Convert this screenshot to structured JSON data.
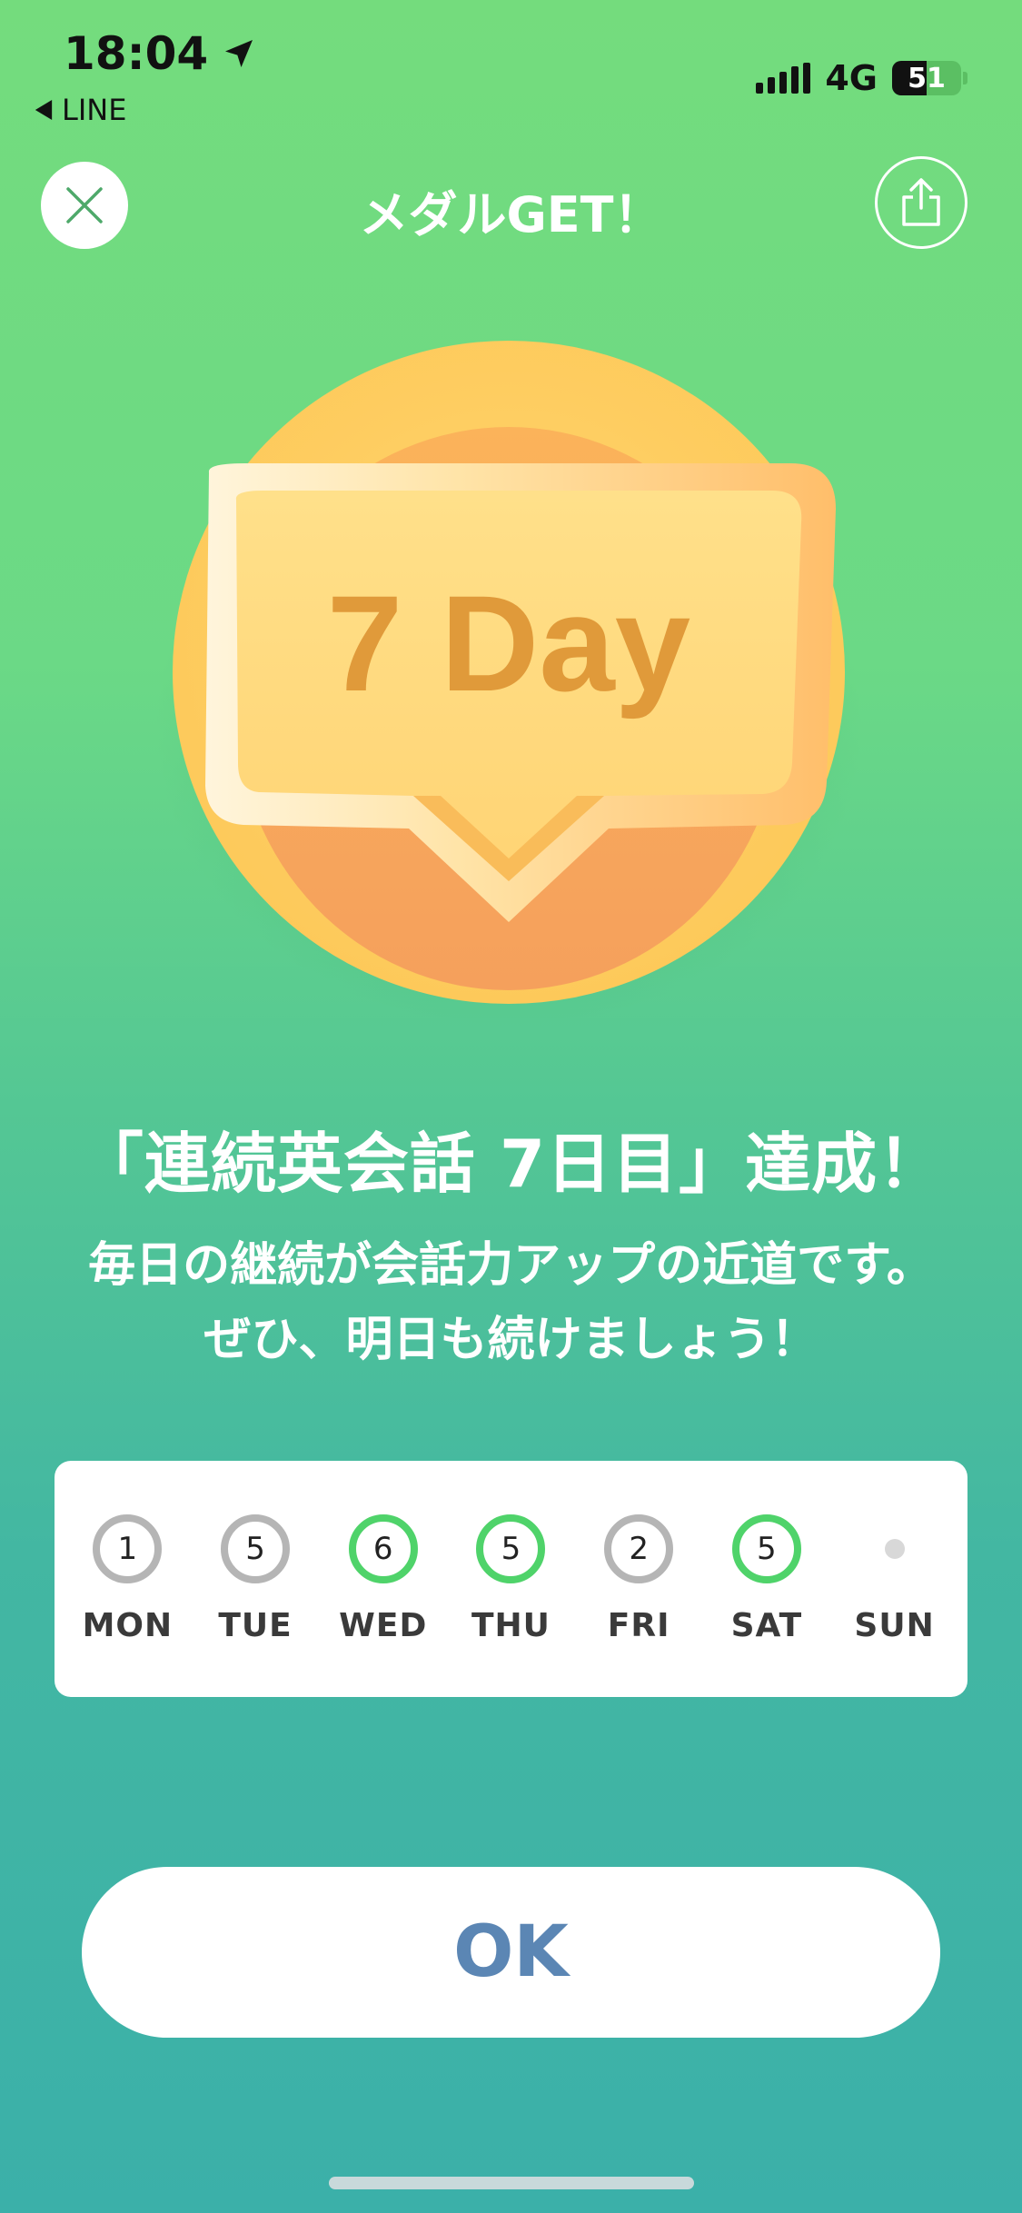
{
  "status_bar": {
    "time": "18:04",
    "back_app": "LINE",
    "network": "4G",
    "battery": "51"
  },
  "header": {
    "title": "メダルGET！"
  },
  "medal": {
    "label": "7 Day"
  },
  "achievement": {
    "headline": "「連続英会話 7日目」達成！",
    "message_line1": "毎日の継続が会話力アップの近道です。",
    "message_line2": "ぜひ、明日も続けましょう！"
  },
  "week": {
    "days": [
      {
        "label": "MON",
        "count": "1",
        "status": "gray"
      },
      {
        "label": "TUE",
        "count": "5",
        "status": "gray"
      },
      {
        "label": "WED",
        "count": "6",
        "status": "green"
      },
      {
        "label": "THU",
        "count": "5",
        "status": "green"
      },
      {
        "label": "FRI",
        "count": "2",
        "status": "gray"
      },
      {
        "label": "SAT",
        "count": "5",
        "status": "green"
      },
      {
        "label": "SUN",
        "count": "",
        "status": "empty"
      }
    ]
  },
  "ok_button": {
    "label": "OK"
  },
  "colors": {
    "green_ring": "#4fd36a",
    "gray_ring": "#b5b5b5",
    "ok_text": "#5b86b4",
    "medal_text": "#e09a3a"
  }
}
